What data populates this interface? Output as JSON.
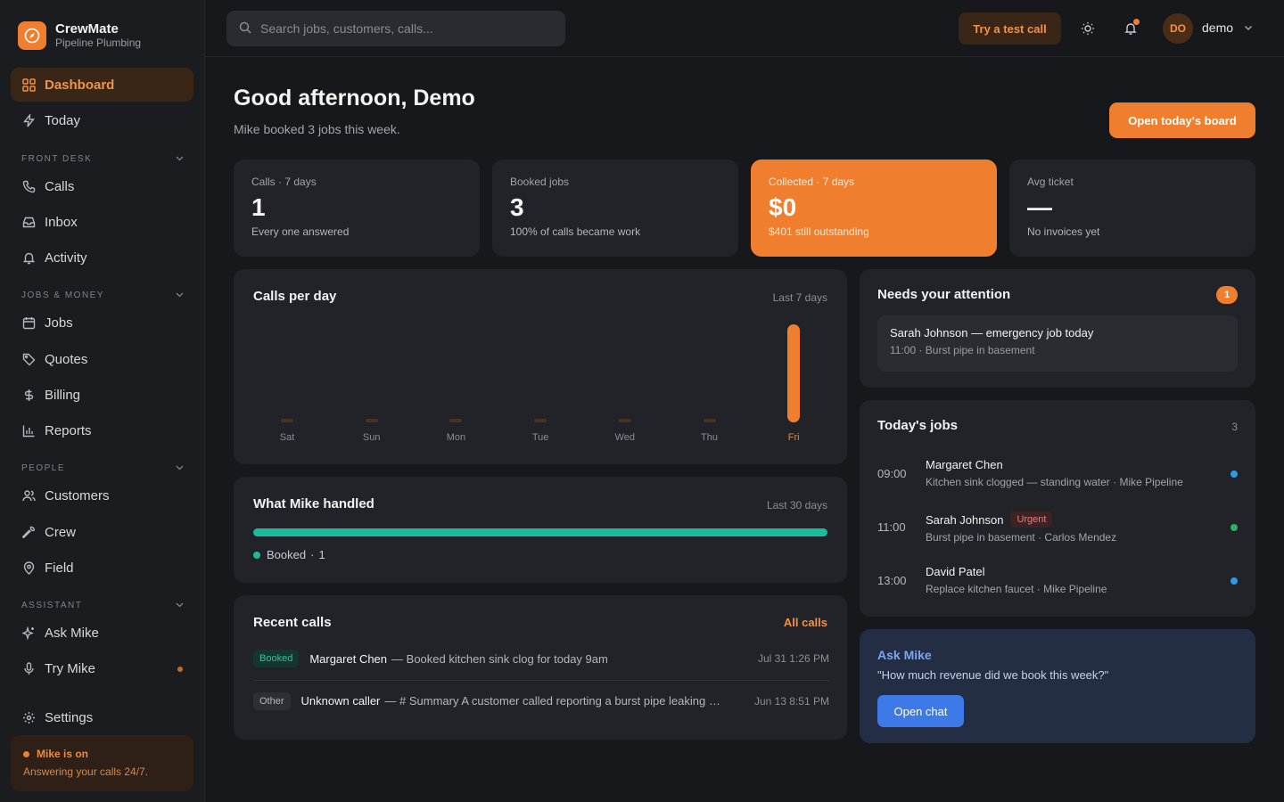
{
  "brand": {
    "name": "CrewMate",
    "subtitle": "Pipeline Plumbing"
  },
  "nav": {
    "dashboard": "Dashboard",
    "today": "Today",
    "section_front_desk": "FRONT DESK",
    "calls": "Calls",
    "inbox": "Inbox",
    "activity": "Activity",
    "section_jobs_money": "JOBS & MONEY",
    "jobs": "Jobs",
    "quotes": "Quotes",
    "billing": "Billing",
    "reports": "Reports",
    "section_people": "PEOPLE",
    "customers": "Customers",
    "crew": "Crew",
    "field": "Field",
    "section_assistant": "ASSISTANT",
    "ask_mike": "Ask Mike",
    "try_mike": "Try Mike",
    "settings": "Settings"
  },
  "status": {
    "title": "Mike is on",
    "subtitle": "Answering your calls 24/7."
  },
  "topbar": {
    "search_placeholder": "Search jobs, customers, calls...",
    "test_call": "Try a test call",
    "avatar_initials": "DO",
    "user_name": "demo"
  },
  "header": {
    "greeting": "Good afternoon, Demo",
    "subtitle": "Mike booked 3 jobs this week.",
    "primary_action": "Open today's board"
  },
  "stats": [
    {
      "label": "Calls · 7 days",
      "value": "1",
      "sub": "Every one answered"
    },
    {
      "label": "Booked jobs",
      "value": "3",
      "sub": "100% of calls became work"
    },
    {
      "label": "Collected · 7 days",
      "value": "$0",
      "sub": "$401 still outstanding"
    },
    {
      "label": "Avg ticket",
      "value": "—",
      "sub": "No invoices yet"
    }
  ],
  "calls_chart": {
    "title": "Calls per day",
    "range": "Last 7 days",
    "accent": "#ef7f2e",
    "empty_color": "#4a3220"
  },
  "chart_data": {
    "type": "bar",
    "categories": [
      "Sat",
      "Sun",
      "Mon",
      "Tue",
      "Wed",
      "Thu",
      "Fri"
    ],
    "values": [
      0,
      0,
      0,
      0,
      0,
      0,
      1
    ],
    "title": "Calls per day",
    "ylim": [
      0,
      1
    ]
  },
  "handled": {
    "title": "What Mike handled",
    "range": "Last 30 days",
    "legend_label": "Booked",
    "legend_sep": "·",
    "legend_count": "1",
    "booked_fraction": 1.0
  },
  "recent_calls": {
    "title": "Recent calls",
    "link": "All calls",
    "rows": [
      {
        "tag": "Booked",
        "name": "Margaret Chen",
        "desc": "— Booked kitchen sink clog for today 9am",
        "date": "Jul 31 1:26 PM"
      },
      {
        "tag": "Other",
        "name": "Unknown caller",
        "desc": "— # Summary A customer called reporting a burst pipe leaking …",
        "date": "Jun 13 8:51 PM"
      }
    ]
  },
  "attention": {
    "title": "Needs your attention",
    "count": "1",
    "item_title": "Sarah Johnson — emergency job today",
    "item_sub": "11:00 · Burst pipe in basement"
  },
  "todays_jobs": {
    "title": "Today's jobs",
    "count": "3",
    "rows": [
      {
        "time": "09:00",
        "name": "Margaret Chen",
        "desc": "Kitchen sink clogged — standing water · Mike Pipeline",
        "badge": "",
        "dot": "#2f9be8"
      },
      {
        "time": "11:00",
        "name": "Sarah Johnson",
        "desc": "Burst pipe in basement · Carlos Mendez",
        "badge": "Urgent",
        "dot": "#2fb05c"
      },
      {
        "time": "13:00",
        "name": "David Patel",
        "desc": "Replace kitchen faucet · Mike Pipeline",
        "badge": "",
        "dot": "#2f9be8"
      }
    ]
  },
  "ask": {
    "title": "Ask Mike",
    "quote": "\"How much revenue did we book this week?\"",
    "button": "Open chat"
  },
  "colors": {
    "accent": "#ef7f2e",
    "teal": "#1bbc9b",
    "blue": "#3d7ae8"
  }
}
